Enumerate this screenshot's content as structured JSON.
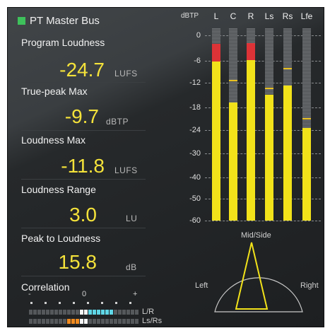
{
  "bus": {
    "name": "PT Master Bus",
    "indicator_color": "#3ec15b"
  },
  "metrics": [
    {
      "label": "Program Loudness",
      "value": "-24.7",
      "unit": "LUFS"
    },
    {
      "label": "True-peak Max",
      "value": "-9.7",
      "unit": "dBTP"
    },
    {
      "label": "Loudness Max",
      "value": "-11.8",
      "unit": "LUFS"
    },
    {
      "label": "Loudness Range",
      "value": "3.0",
      "unit": "LU"
    },
    {
      "label": "Peak to Loudness",
      "value": "15.8",
      "unit": "dB"
    }
  ],
  "correlation": {
    "label": "Correlation",
    "ticks": [
      "-",
      "0",
      "+"
    ],
    "rows": [
      {
        "label": "L/R",
        "active_color": "#5fd6e6",
        "value": 0.55
      },
      {
        "label": "Ls/Rs",
        "active_color": "#f08a1f",
        "value": -0.3
      }
    ]
  },
  "meter": {
    "title": "dBTP",
    "scale": [
      "0",
      "-6",
      "-12",
      "-18",
      "-24",
      "-30",
      "-40",
      "-50",
      "-60"
    ],
    "channels": [
      {
        "name": "L",
        "level": -6.1,
        "peak_hold": -2.0,
        "over": true
      },
      {
        "name": "C",
        "level": -16.8,
        "peak_hold": -11.2,
        "over": false
      },
      {
        "name": "R",
        "level": -5.8,
        "peak_hold": -1.8,
        "over": true
      },
      {
        "name": "Ls",
        "level": -14.9,
        "peak_hold": -13.2,
        "over": false
      },
      {
        "name": "Rs",
        "level": -12.6,
        "peak_hold": -8.0,
        "over": false
      },
      {
        "name": "Lfe",
        "level": -23.4,
        "peak_hold": -20.8,
        "over": false
      }
    ],
    "colors": {
      "level": "#f2e21a",
      "over": "#dd3337"
    }
  },
  "midside": {
    "title": "Mid/Side",
    "left_label": "Left",
    "right_label": "Right"
  }
}
